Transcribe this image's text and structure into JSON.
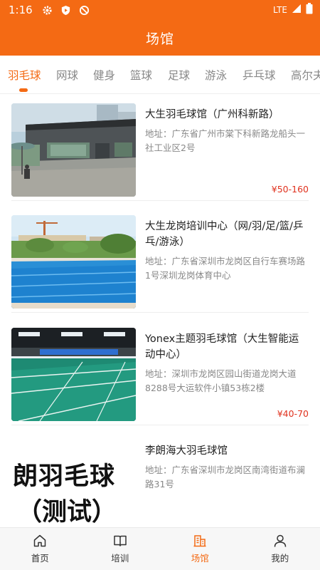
{
  "status_bar": {
    "time": "1:16",
    "network": "LTE",
    "icons": [
      "gear-icon",
      "shield-play-icon",
      "no-signal-circle-icon",
      "signal-icon",
      "battery-icon"
    ]
  },
  "header": {
    "title": "场馆"
  },
  "tabs": [
    {
      "label": "羽毛球",
      "active": true
    },
    {
      "label": "网球"
    },
    {
      "label": "健身"
    },
    {
      "label": "篮球"
    },
    {
      "label": "足球"
    },
    {
      "label": "游泳"
    },
    {
      "label": "乒乓球"
    },
    {
      "label": "高尔夫"
    }
  ],
  "venues": [
    {
      "name": "大生羽毛球馆（广州科新路）",
      "address": "地址：广东省广州市棠下科新路龙船头一社工业区2号",
      "price": "¥50-160"
    },
    {
      "name": "大生龙岗培训中心（网/羽/足/篮/乒乓/游泳）",
      "address": "地址：广东省深圳市龙岗区自行车赛场路1号深圳龙岗体育中心",
      "price": ""
    },
    {
      "name": "Yonex主题羽毛球馆（大生智能运动中心）",
      "address": "地址：深圳市龙岗区园山街道龙岗大道8288号大运软件小镇53栋2楼",
      "price": "¥40-70"
    },
    {
      "name": "李朗海大羽毛球馆",
      "address": "地址：广东省深圳市龙岗区南湾街道布澜路31号",
      "price": "",
      "thumb_text_line1": "朗羽毛球",
      "thumb_text_line2": "（测试）"
    }
  ],
  "bottom_nav": [
    {
      "label": "首页",
      "icon": "home-icon"
    },
    {
      "label": "培训",
      "icon": "book-icon"
    },
    {
      "label": "场馆",
      "icon": "venue-icon",
      "active": true
    },
    {
      "label": "我的",
      "icon": "person-icon"
    }
  ],
  "colors": {
    "brand": "#f46a14",
    "price": "#e0321e"
  }
}
